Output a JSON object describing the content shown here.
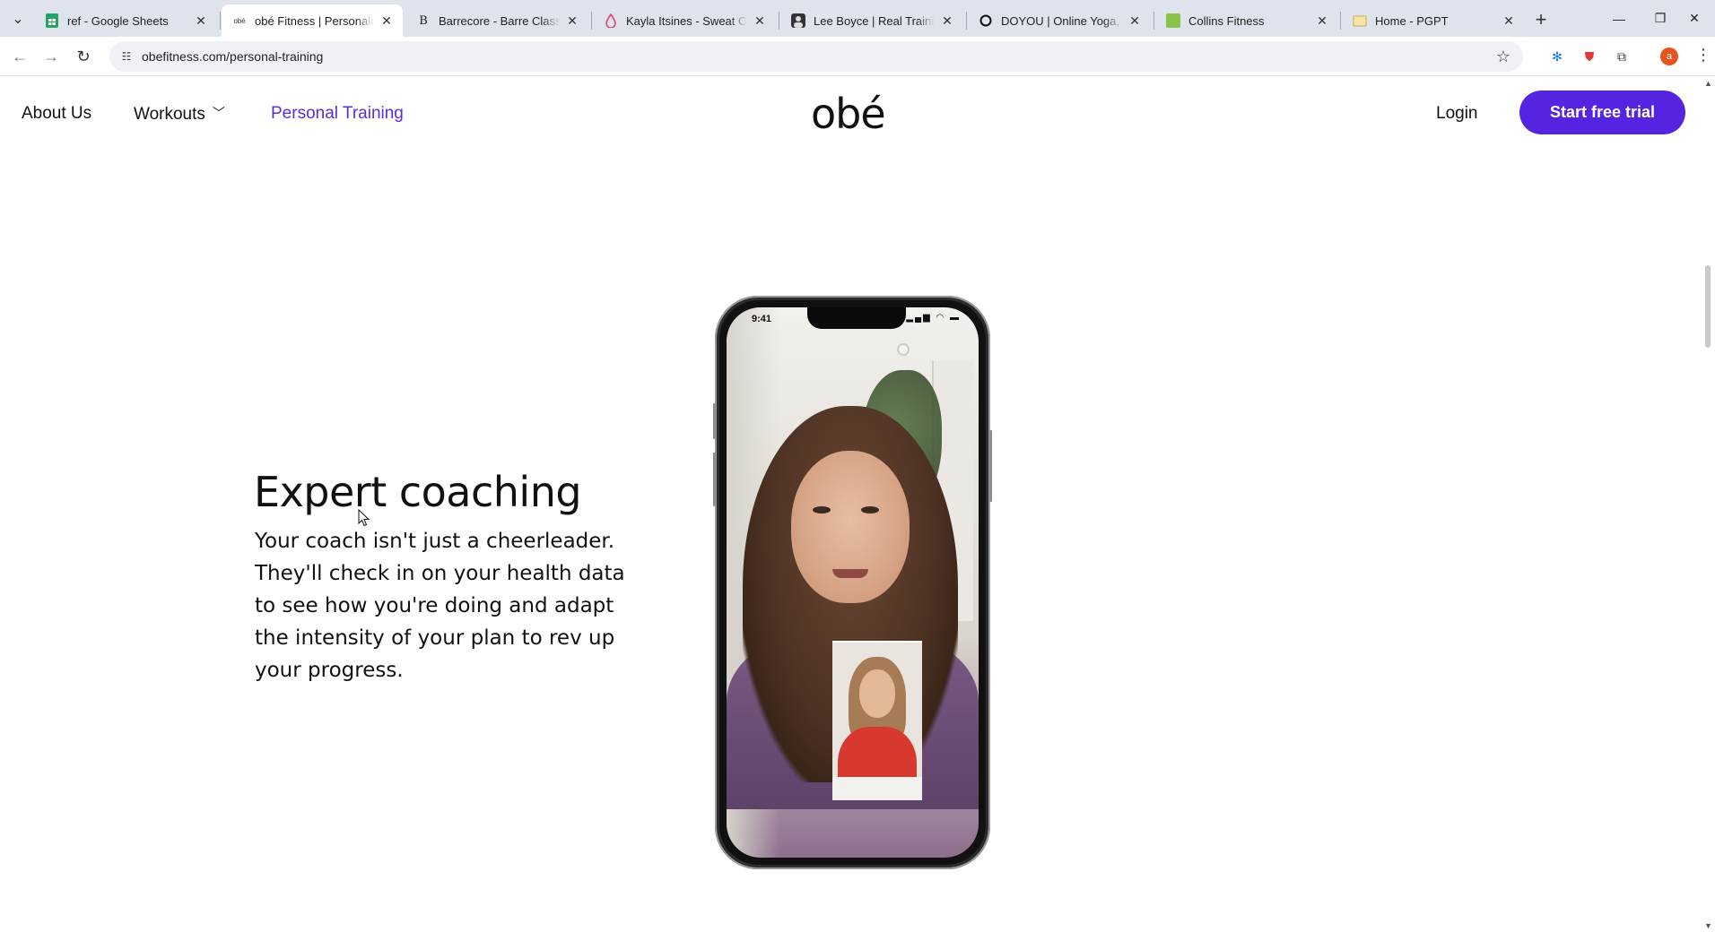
{
  "browser": {
    "tabs": [
      {
        "title": "ref - Google Sheets",
        "favicon": "sheets-icon",
        "active": false
      },
      {
        "title": "obé Fitness | Personalized",
        "favicon": "obe-icon",
        "active": true
      },
      {
        "title": "Barrecore - Barre Classes",
        "favicon": "barrecore-icon",
        "active": false
      },
      {
        "title": "Kayla Itsines - Sweat Co-F",
        "favicon": "sweat-icon",
        "active": false
      },
      {
        "title": "Lee Boyce | Real Training.",
        "favicon": "leeboyce-icon",
        "active": false
      },
      {
        "title": "DOYOU | Online Yoga, Fit",
        "favicon": "doyou-icon",
        "active": false
      },
      {
        "title": "Collins Fitness",
        "favicon": "collins-icon",
        "active": false
      },
      {
        "title": "Home - PGPT",
        "favicon": "pgpt-icon",
        "active": false
      }
    ],
    "url": "obefitness.com/personal-training",
    "profile_initial": "a"
  },
  "site_nav": {
    "about": "About Us",
    "workouts": "Workouts",
    "personal_training": "Personal Training",
    "logo": "obé",
    "login": "Login",
    "cta": "Start free trial"
  },
  "hero": {
    "title": "Expert coaching",
    "body": "Your coach isn't just a cheerleader. They'll check in on your health data to see how you're doing and adapt the intensity of your plan to rev up your progress."
  },
  "phone": {
    "status_time": "9:41"
  },
  "colors": {
    "accent": "#5424e0",
    "active_link": "#5b2be0",
    "tabstrip": "#dfe3eb"
  }
}
